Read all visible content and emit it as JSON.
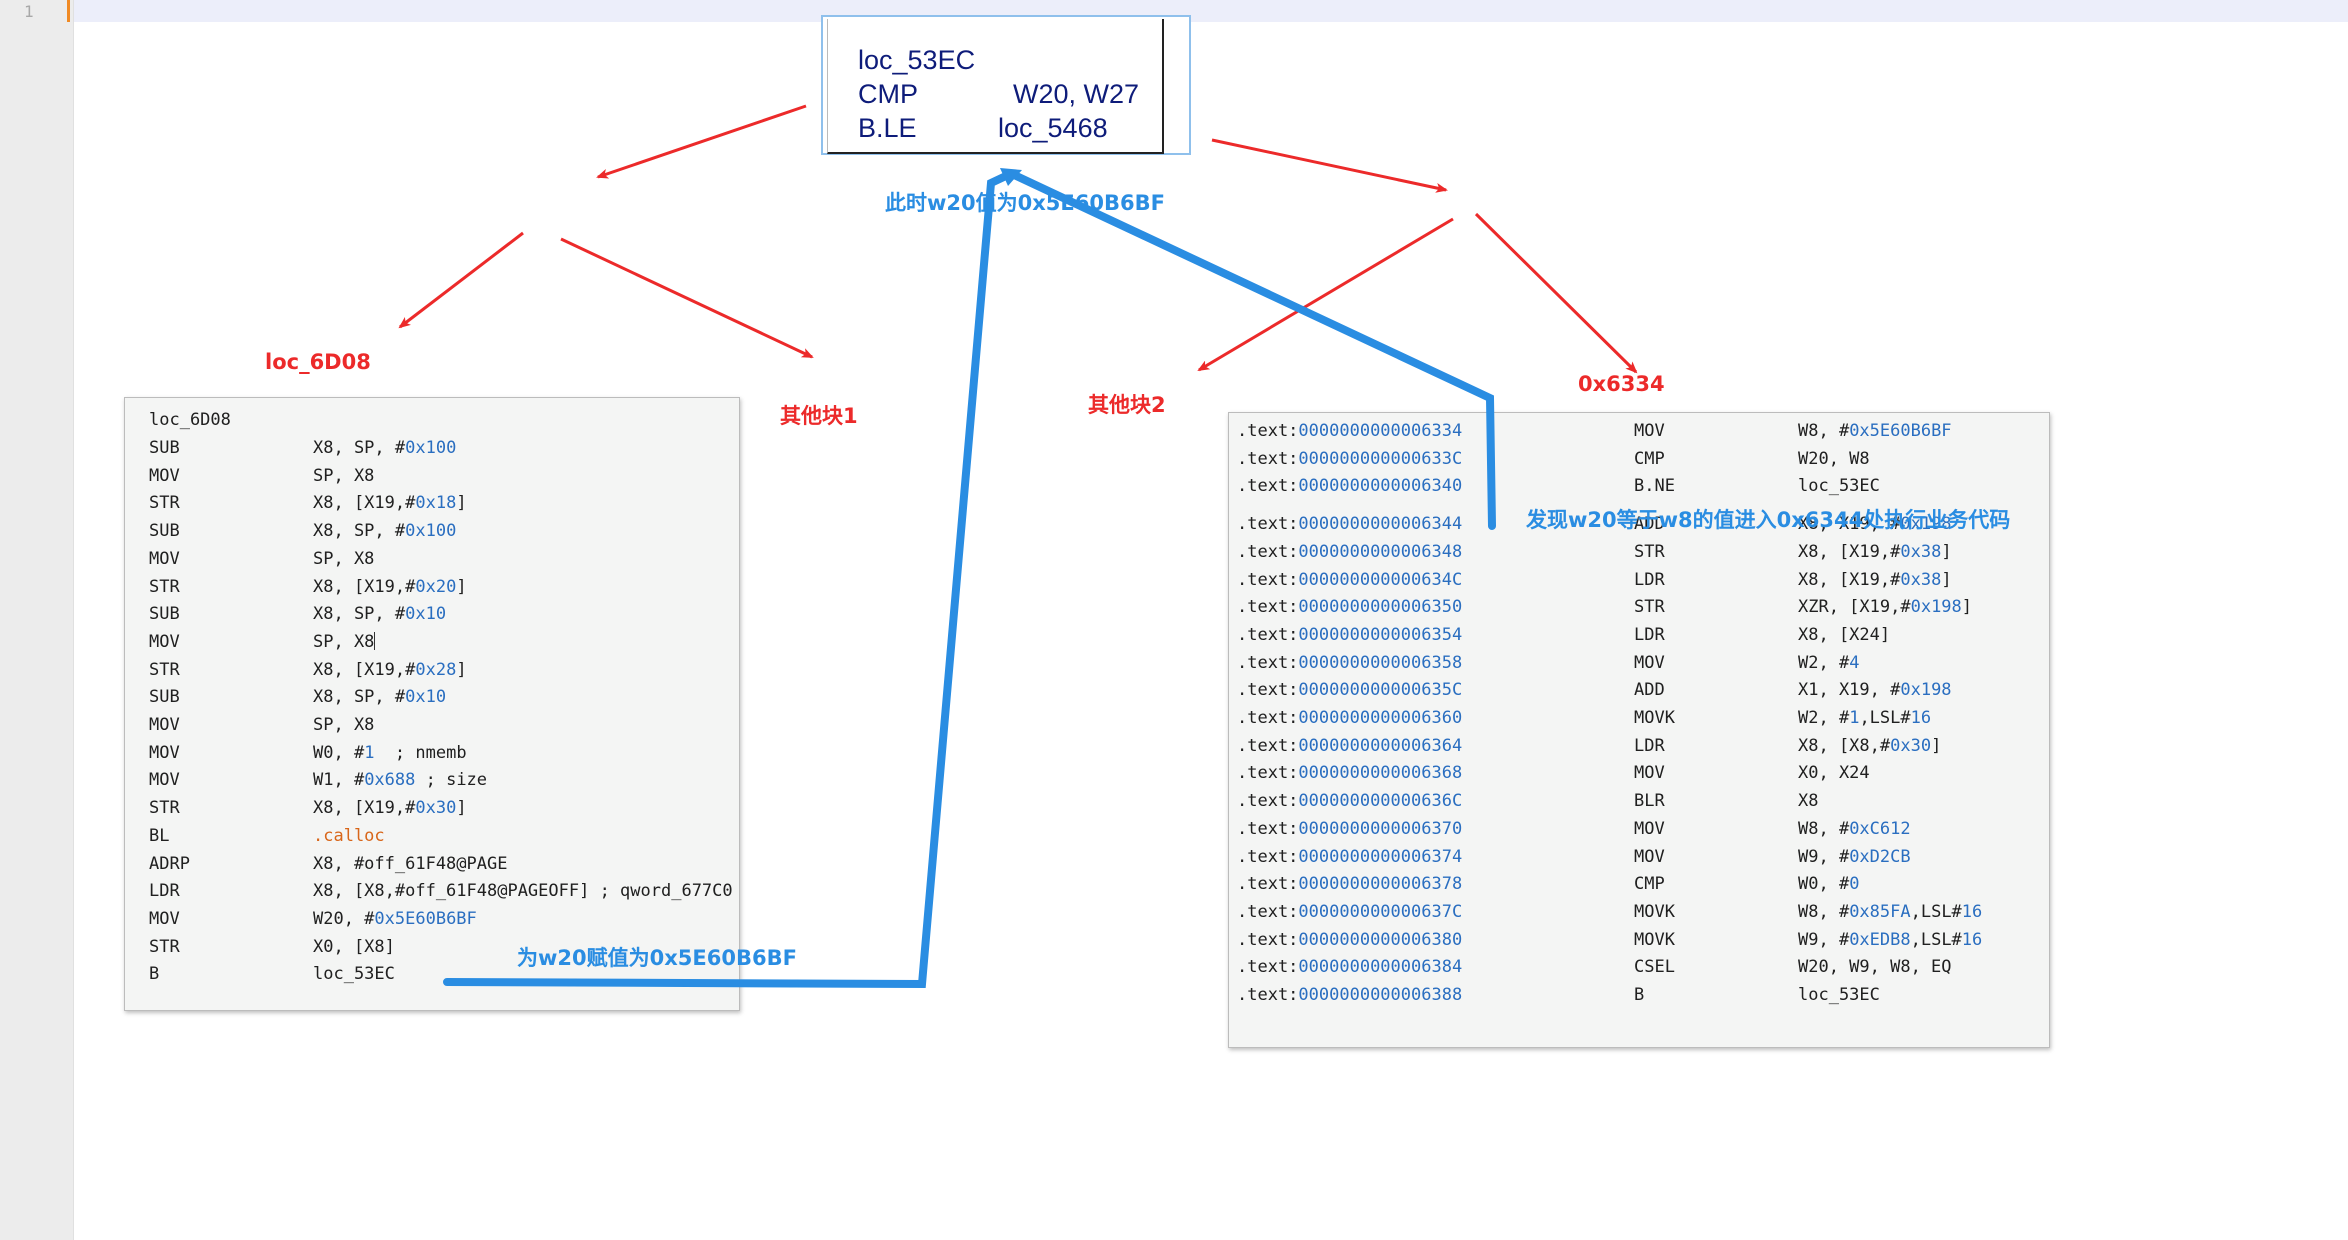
{
  "editor": {
    "line_number": "1"
  },
  "top_block": {
    "lines": [
      {
        "op": "loc_53EC",
        "args": ""
      },
      {
        "op": "CMP",
        "args": "W20, W27"
      },
      {
        "op": "B.LE",
        "args": "loc_5468"
      }
    ]
  },
  "annotations": {
    "w20_value_at_branch": "此时w20值为0x5E60B6BF",
    "loc_6D08": "loc_6D08",
    "other_block_1": "其他块1",
    "other_block_2": "其他块2",
    "addr_0x6334": "0x6334",
    "assign_w20": "为w20赋值为0x5E60B6BF",
    "w20_equals_w8": "发现w20等于w8的值进入0x6344处执行业务代码"
  },
  "left_block": {
    "title": "loc_6D08",
    "lines": [
      {
        "op": "SUB",
        "args": [
          [
            "X8, SP, #",
            ""
          ],
          [
            "0x100",
            "num"
          ]
        ]
      },
      {
        "op": "MOV",
        "args": [
          [
            "SP, X8",
            ""
          ]
        ]
      },
      {
        "op": "STR",
        "args": [
          [
            "X8, [X19,#",
            ""
          ],
          [
            "0x18",
            "num"
          ],
          [
            "]",
            ""
          ]
        ]
      },
      {
        "op": "SUB",
        "args": [
          [
            "X8, SP, #",
            ""
          ],
          [
            "0x100",
            "num"
          ]
        ]
      },
      {
        "op": "MOV",
        "args": [
          [
            "SP, X8",
            ""
          ]
        ]
      },
      {
        "op": "STR",
        "args": [
          [
            "X8, [X19,#",
            ""
          ],
          [
            "0x20",
            "num"
          ],
          [
            "]",
            ""
          ]
        ]
      },
      {
        "op": "SUB",
        "args": [
          [
            "X8, SP, #",
            ""
          ],
          [
            "0x10",
            "num"
          ]
        ]
      },
      {
        "op": "MOV",
        "args": [
          [
            "SP, X8",
            ""
          ],
          [
            "|",
            "caret"
          ]
        ]
      },
      {
        "op": "STR",
        "args": [
          [
            "X8, [X19,#",
            ""
          ],
          [
            "0x28",
            "num"
          ],
          [
            "]",
            ""
          ]
        ]
      },
      {
        "op": "SUB",
        "args": [
          [
            "X8, SP, #",
            ""
          ],
          [
            "0x10",
            "num"
          ]
        ]
      },
      {
        "op": "MOV",
        "args": [
          [
            "SP, X8",
            ""
          ]
        ]
      },
      {
        "op": "MOV",
        "args": [
          [
            "W0, #",
            ""
          ],
          [
            "1",
            "num"
          ],
          [
            "  ; nmemb",
            ""
          ]
        ]
      },
      {
        "op": "MOV",
        "args": [
          [
            "W1, #",
            ""
          ],
          [
            "0x688",
            "num"
          ],
          [
            " ; size",
            ""
          ]
        ]
      },
      {
        "op": "STR",
        "args": [
          [
            "X8, [X19,#",
            ""
          ],
          [
            "0x30",
            "num"
          ],
          [
            "]",
            ""
          ]
        ]
      },
      {
        "op": "BL",
        "args": [
          [
            ".calloc",
            "call"
          ]
        ]
      },
      {
        "op": "ADRP",
        "args": [
          [
            "X8, #off_61F48@PAGE",
            ""
          ]
        ]
      },
      {
        "op": "LDR",
        "args": [
          [
            "X8, [X8,#off_61F48@PAGEOFF] ; qword_677C0",
            ""
          ]
        ]
      },
      {
        "op": "MOV",
        "args": [
          [
            "W20, #",
            ""
          ],
          [
            "0x5E60B6BF",
            "num"
          ]
        ]
      },
      {
        "op": "STR",
        "args": [
          [
            "X0, [X8]",
            ""
          ]
        ]
      },
      {
        "op": "B",
        "args": [
          [
            "loc_53EC",
            ""
          ]
        ]
      }
    ]
  },
  "right_block": {
    "segment": ".text:",
    "lines": [
      {
        "addr": "0000000000006334",
        "op": "MOV",
        "args": [
          [
            "W8, #",
            ""
          ],
          [
            "0x5E60B6BF",
            "num"
          ]
        ]
      },
      {
        "addr": "000000000000633C",
        "op": "CMP",
        "args": [
          [
            "W20, W8",
            ""
          ]
        ]
      },
      {
        "addr": "0000000000006340",
        "op": "B.NE",
        "args": [
          [
            "loc_53EC",
            ""
          ]
        ]
      },
      {
        "addr": "0000000000006344",
        "op": "ADD",
        "args": [
          [
            "X8, X19, #",
            ""
          ],
          [
            "0x198",
            "num"
          ]
        ]
      },
      {
        "addr": "0000000000006348",
        "op": "STR",
        "args": [
          [
            "X8, [X19,#",
            ""
          ],
          [
            "0x38",
            "num"
          ],
          [
            "]",
            ""
          ]
        ]
      },
      {
        "addr": "000000000000634C",
        "op": "LDR",
        "args": [
          [
            "X8, [X19,#",
            ""
          ],
          [
            "0x38",
            "num"
          ],
          [
            "]",
            ""
          ]
        ]
      },
      {
        "addr": "0000000000006350",
        "op": "STR",
        "args": [
          [
            "XZR, [X19,#",
            ""
          ],
          [
            "0x198",
            "num"
          ],
          [
            "]",
            ""
          ]
        ]
      },
      {
        "addr": "0000000000006354",
        "op": "LDR",
        "args": [
          [
            "X8, [X24]",
            ""
          ]
        ]
      },
      {
        "addr": "0000000000006358",
        "op": "MOV",
        "args": [
          [
            "W2, #",
            ""
          ],
          [
            "4",
            "num"
          ]
        ]
      },
      {
        "addr": "000000000000635C",
        "op": "ADD",
        "args": [
          [
            "X1, X19, #",
            ""
          ],
          [
            "0x198",
            "num"
          ]
        ]
      },
      {
        "addr": "0000000000006360",
        "op": "MOVK",
        "args": [
          [
            "W2, #",
            ""
          ],
          [
            "1",
            "num"
          ],
          [
            ",LSL#",
            ""
          ],
          [
            "16",
            "num"
          ]
        ]
      },
      {
        "addr": "0000000000006364",
        "op": "LDR",
        "args": [
          [
            "X8, [X8,#",
            ""
          ],
          [
            "0x30",
            "num"
          ],
          [
            "]",
            ""
          ]
        ]
      },
      {
        "addr": "0000000000006368",
        "op": "MOV",
        "args": [
          [
            "X0, X24",
            ""
          ]
        ]
      },
      {
        "addr": "000000000000636C",
        "op": "BLR",
        "args": [
          [
            "X8",
            ""
          ]
        ]
      },
      {
        "addr": "0000000000006370",
        "op": "MOV",
        "args": [
          [
            "W8, #",
            ""
          ],
          [
            "0xC612",
            "num"
          ]
        ]
      },
      {
        "addr": "0000000000006374",
        "op": "MOV",
        "args": [
          [
            "W9, #",
            ""
          ],
          [
            "0xD2CB",
            "num"
          ]
        ]
      },
      {
        "addr": "0000000000006378",
        "op": "CMP",
        "args": [
          [
            "W0, #",
            ""
          ],
          [
            "0",
            "num"
          ]
        ]
      },
      {
        "addr": "000000000000637C",
        "op": "MOVK",
        "args": [
          [
            "W8, #",
            ""
          ],
          [
            "0x85FA",
            "num"
          ],
          [
            ",LSL#",
            ""
          ],
          [
            "16",
            "num"
          ]
        ]
      },
      {
        "addr": "0000000000006380",
        "op": "MOVK",
        "args": [
          [
            "W9, #",
            ""
          ],
          [
            "0xEDB8",
            "num"
          ],
          [
            ",LSL#",
            ""
          ],
          [
            "16",
            "num"
          ]
        ]
      },
      {
        "addr": "0000000000006384",
        "op": "CSEL",
        "args": [
          [
            "W20, W9, W8, EQ",
            ""
          ]
        ]
      },
      {
        "addr": "0000000000006388",
        "op": "B",
        "args": [
          [
            "loc_53EC",
            ""
          ]
        ]
      }
    ]
  },
  "colors": {
    "arrow_red": "#ec2a2a",
    "flow_blue": "#2a8de2",
    "immediate_blue": "#2a6ec0",
    "call_orange": "#d8661a",
    "asm_navy": "#0e1c7a"
  }
}
